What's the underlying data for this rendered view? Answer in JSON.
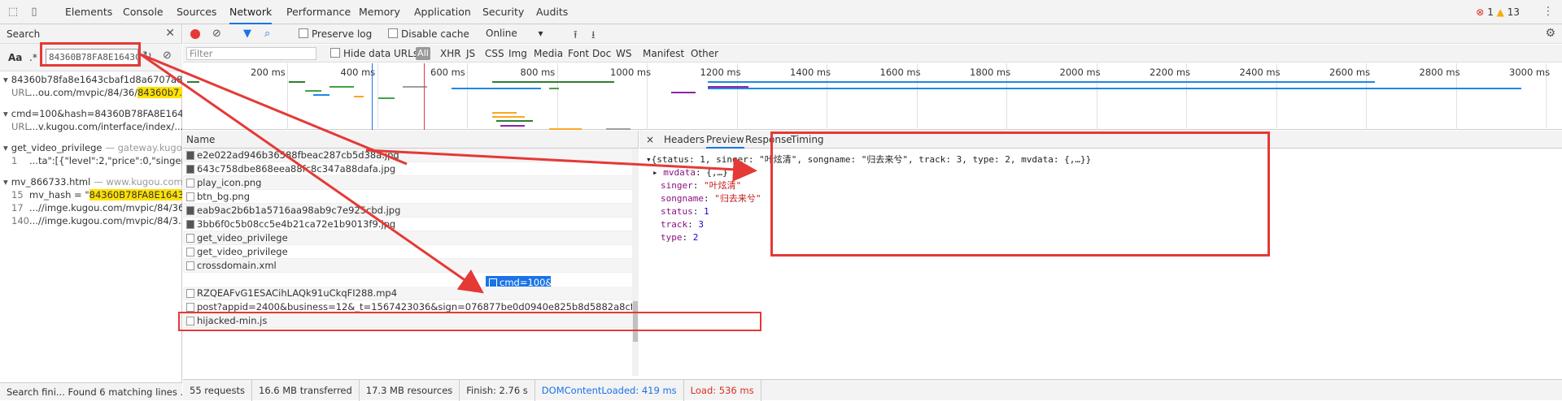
{
  "topbar": {
    "tabs": [
      "Elements",
      "Console",
      "Sources",
      "Network",
      "Performance",
      "Memory",
      "Application",
      "Security",
      "Audits"
    ],
    "active_tab": "Network",
    "error_count": "1",
    "warning_count": "13"
  },
  "search_panel": {
    "title": "Search",
    "aa_label": "Aa",
    "regex_label": ".*",
    "query": "84360B78FA8E1643C",
    "results": [
      {
        "file": "84360b78fa8e1643cbaf1d8a6707a8ea...",
        "line_label": "URL",
        "line_text_pre": "...ou.com/mvpic/84/36/",
        "line_text_hl": "84360b7..."
      },
      {
        "file": "cmd=100&hash=84360B78FA8E1643...",
        "line_label": "URL",
        "line_text_pre": "...v.kugou.com/interface/index/...",
        "line_text_hl": ""
      },
      {
        "file": "get_video_privilege",
        "file_host": "— gateway.kugo...",
        "line_label": "1",
        "line_text_pre": "...ta\":[{\"level\":2,\"price\":0,\"singer_na...",
        "line_text_hl": ""
      },
      {
        "file": "mv_866733.html",
        "file_host": "— www.kugou.com/...",
        "lines": [
          {
            "num": "15",
            "pre": "mv_hash = \"",
            "hl": "84360B78FA8E1643C..."
          },
          {
            "num": "17",
            "pre": "...//imge.kugou.com/mvpic/84/36...",
            "hl": ""
          },
          {
            "num": "140",
            "pre": "...//imge.kugou.com/mvpic/84/3...",
            "hl": ""
          }
        ]
      }
    ],
    "status": "Search fini... Found 6 matching lines ..."
  },
  "toolbar": {
    "preserve_log": "Preserve log",
    "disable_cache": "Disable cache",
    "throttle": "Online",
    "filter_placeholder": "Filter",
    "hide_data_urls": "Hide data URLs",
    "all": "All",
    "types": [
      "XHR",
      "JS",
      "CSS",
      "Img",
      "Media",
      "Font",
      "Doc",
      "WS",
      "Manifest",
      "Other"
    ]
  },
  "timeline": {
    "ticks": [
      "200 ms",
      "400 ms",
      "600 ms",
      "800 ms",
      "1000 ms",
      "1200 ms",
      "1400 ms",
      "1600 ms",
      "1800 ms",
      "2000 ms",
      "2200 ms",
      "2400 ms",
      "2600 ms",
      "2800 ms",
      "3000 ms"
    ]
  },
  "requests": {
    "header": "Name",
    "rows": [
      {
        "name": "e2e022ad946b36588fbeac287cb5d38a.jpg",
        "img": true
      },
      {
        "name": "643c758dbe868eea88fc8c347a88dafa.jpg",
        "img": true
      },
      {
        "name": "play_icon.png",
        "img": false
      },
      {
        "name": "btn_bg.png",
        "img": false
      },
      {
        "name": "eab9ac2b6b1a5716aa98ab9c7e925cbd.jpg",
        "img": true
      },
      {
        "name": "3bb6f0c5b08cc5e4b21ca72e1b9013f9.jpg",
        "img": true
      },
      {
        "name": "get_video_privilege",
        "img": false
      },
      {
        "name": "get_video_privilege",
        "img": false
      },
      {
        "name": "crossdomain.xml",
        "img": false
      },
      {
        "name": "cmd=100&hash=84360B78FA8E1643CBAF1D8A6707A8EA&key=...2bfdaea099813561e5cb9ee9a1f&pid=6&ext=mp4&ismp3=0",
        "img": false,
        "selected": true
      },
      {
        "name": "RZQEAFvG1ESACihLAQk91uCkqFI288.mp4",
        "img": false
      },
      {
        "name": "post?appid=2400&business=12&_t=1567423036&sign=076877be0d0940e825b8d5882a8cf7ac",
        "img": false
      },
      {
        "name": "hijacked-min.js",
        "img": false
      }
    ]
  },
  "detail": {
    "close": "×",
    "tabs": [
      "Headers",
      "Preview",
      "Response",
      "Timing"
    ],
    "active_tab": "Preview",
    "summary": "{status: 1, singer: \"叶炫清\", songname: \"归去来兮\", track: 3, type: 2, mvdata: {,…}}",
    "props": [
      {
        "key": "mvdata",
        "value": "{,…}",
        "kind": "obj"
      },
      {
        "key": "singer",
        "value": "\"叶炫清\"",
        "kind": "str"
      },
      {
        "key": "songname",
        "value": "\"归去来兮\"",
        "kind": "str"
      },
      {
        "key": "status",
        "value": "1",
        "kind": "num"
      },
      {
        "key": "track",
        "value": "3",
        "kind": "num"
      },
      {
        "key": "type",
        "value": "2",
        "kind": "num"
      }
    ]
  },
  "status_bar": {
    "requests": "55 requests",
    "transferred": "16.6 MB transferred",
    "resources": "17.3 MB resources",
    "finish": "Finish: 2.76 s",
    "dcl": "DOMContentLoaded: 419 ms",
    "load": "Load: 536 ms"
  },
  "colors": {
    "annotation_red": "#e53935",
    "accent_blue": "#1a73e8"
  }
}
